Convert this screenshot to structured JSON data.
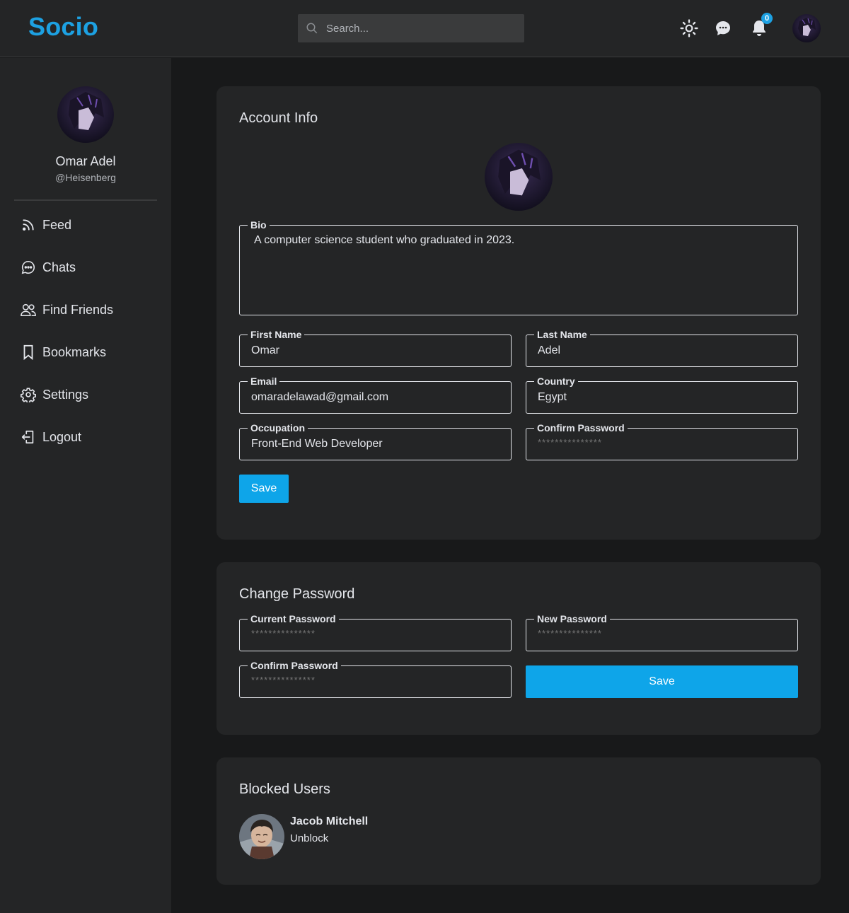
{
  "header": {
    "logo": "Socio",
    "search_placeholder": "Search...",
    "notification_count": "0",
    "icons": [
      "sun-icon",
      "message-icon",
      "bell-icon"
    ]
  },
  "sidebar": {
    "user_name": "Omar Adel",
    "user_handle": "@Heisenberg",
    "items": [
      {
        "label": "Feed",
        "icon": "rss-icon"
      },
      {
        "label": "Chats",
        "icon": "chat-icon"
      },
      {
        "label": "Find Friends",
        "icon": "users-icon"
      },
      {
        "label": "Bookmarks",
        "icon": "bookmark-icon"
      },
      {
        "label": "Settings",
        "icon": "gear-icon"
      },
      {
        "label": "Logout",
        "icon": "logout-icon"
      }
    ]
  },
  "account_info": {
    "title": "Account Info",
    "bio_label": "Bio",
    "bio_value": "A computer science student who graduated in 2023.",
    "first_name_label": "First Name",
    "first_name_value": "Omar",
    "last_name_label": "Last Name",
    "last_name_value": "Adel",
    "email_label": "Email",
    "email_value": "omaradelawad@gmail.com",
    "country_label": "Country",
    "country_value": "Egypt",
    "occupation_label": "Occupation",
    "occupation_value": "Front-End Web Developer",
    "confirm_password_label": "Confirm Password",
    "confirm_password_placeholder": "***************",
    "save_label": "Save"
  },
  "change_password": {
    "title": "Change Password",
    "current_label": "Current Password",
    "current_placeholder": "***************",
    "new_label": "New Password",
    "new_placeholder": "***************",
    "confirm_label": "Confirm Password",
    "confirm_placeholder": "***************",
    "save_label": "Save"
  },
  "blocked_users": {
    "title": "Blocked Users",
    "users": [
      {
        "name": "Jacob Mitchell",
        "action": "Unblock"
      }
    ]
  },
  "colors": {
    "accent": "#0ea5e9",
    "logo": "#1da1e2",
    "surface": "#242526",
    "background": "#18191a",
    "text": "#e4e6eb"
  }
}
